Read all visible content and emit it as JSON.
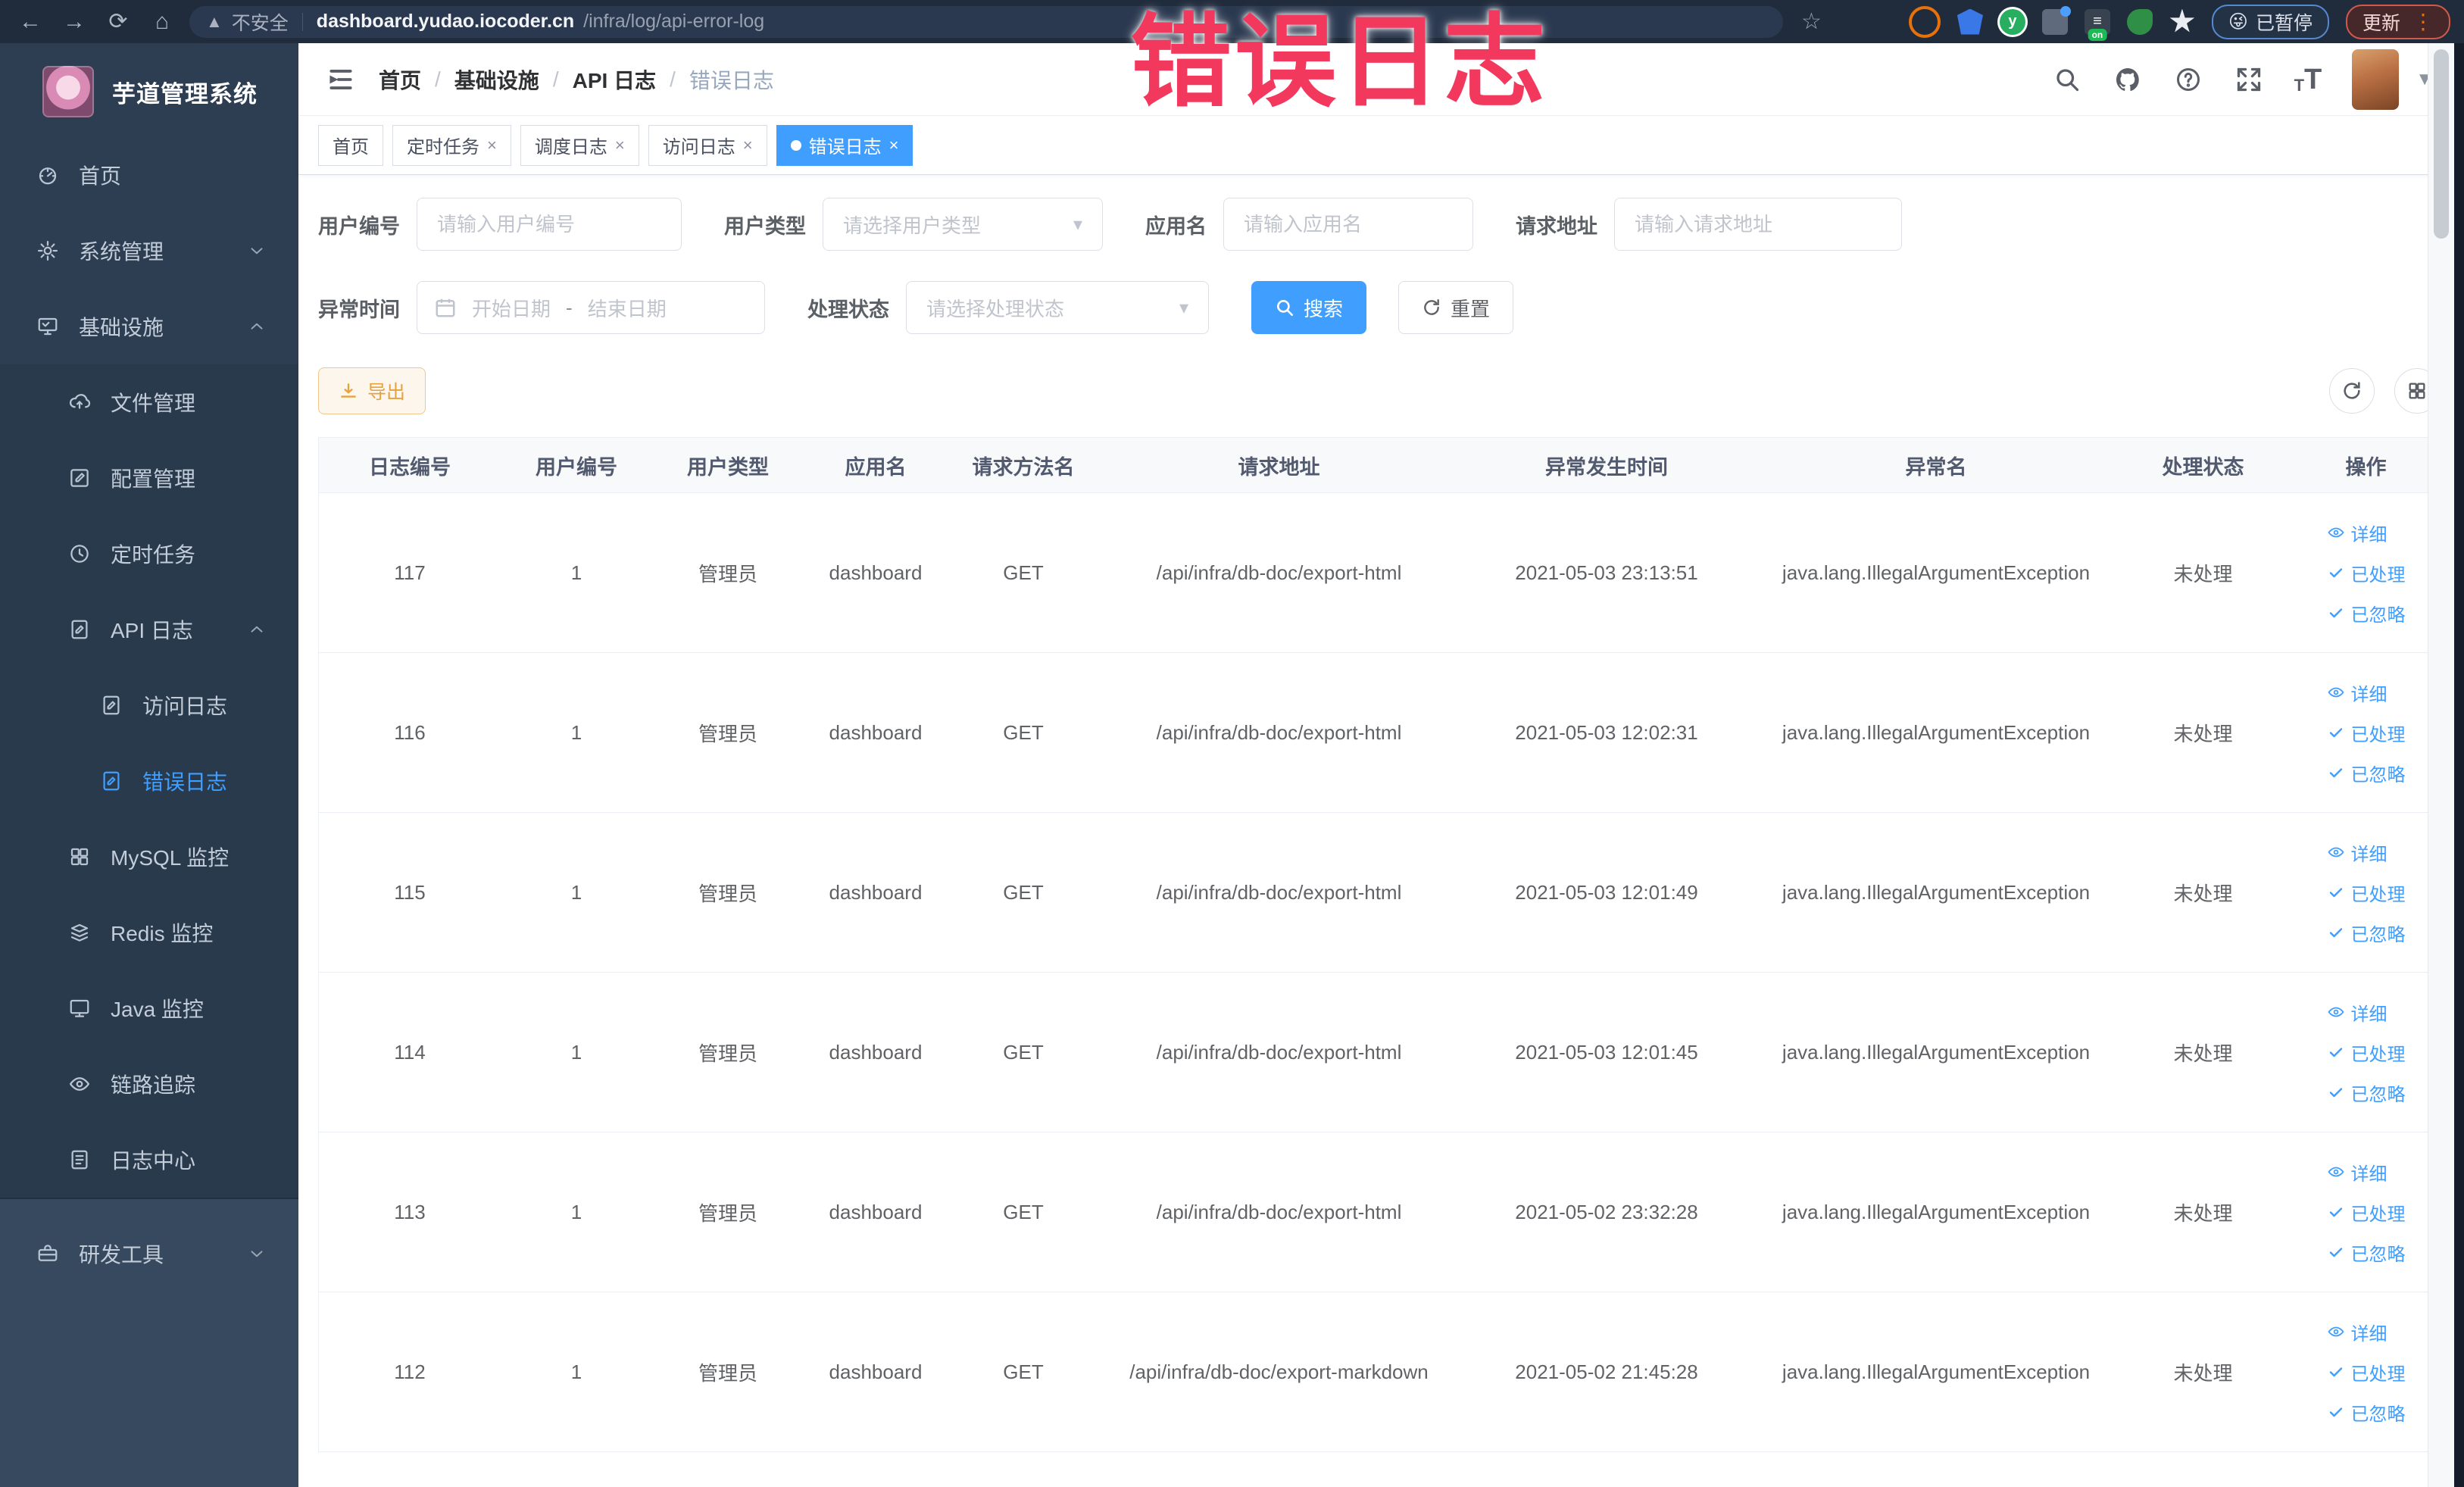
{
  "browser": {
    "security_label": "不安全",
    "url_domain": "dashboard.yudao.iocoder.cn",
    "url_path": "/infra/log/api-error-log",
    "paused_label": "已暂停",
    "paused_emoji": "😜",
    "update_label": "更新"
  },
  "annotation": {
    "text": "错误日志",
    "color": "#f2395d"
  },
  "sidebar": {
    "title": "芋道管理系统",
    "items": [
      {
        "label": "首页",
        "icon": "dashboard",
        "level": 0,
        "section": "top"
      },
      {
        "label": "系统管理",
        "icon": "gear",
        "level": 0,
        "chevron": "down",
        "section": "top"
      },
      {
        "label": "基础设施",
        "icon": "infrastructure",
        "level": 0,
        "chevron": "up",
        "section": "top"
      },
      {
        "label": "文件管理",
        "icon": "cloud-upload",
        "level": 1,
        "submenu": true,
        "section": "top"
      },
      {
        "label": "配置管理",
        "icon": "edit",
        "level": 1,
        "submenu": true,
        "section": "top"
      },
      {
        "label": "定时任务",
        "icon": "timer",
        "level": 1,
        "submenu": true,
        "section": "top"
      },
      {
        "label": "API 日志",
        "icon": "api-log",
        "level": 1,
        "chevron": "up",
        "submenu": true,
        "section": "top"
      },
      {
        "label": "访问日志",
        "icon": "doc-edit",
        "level": 2,
        "submenu": true,
        "section": "top"
      },
      {
        "label": "错误日志",
        "icon": "doc-edit",
        "level": 2,
        "submenu": true,
        "active": true,
        "section": "top"
      },
      {
        "label": "MySQL 监控",
        "icon": "mysql",
        "level": 1,
        "submenu": true,
        "section": "top"
      },
      {
        "label": "Redis 监控",
        "icon": "redis",
        "level": 1,
        "submenu": true,
        "section": "top"
      },
      {
        "label": "Java 监控",
        "icon": "java",
        "level": 1,
        "submenu": true,
        "section": "top"
      },
      {
        "label": "链路追踪",
        "icon": "trace",
        "level": 1,
        "submenu": true,
        "section": "top"
      },
      {
        "label": "日志中心",
        "icon": "log-center",
        "level": 1,
        "submenu": true,
        "section": "top"
      },
      {
        "label": "研发工具",
        "icon": "toolbox",
        "level": 0,
        "chevron": "down",
        "section": "bottom"
      }
    ]
  },
  "breadcrumb": [
    "首页",
    "基础设施",
    "API 日志",
    "错误日志"
  ],
  "tabs": [
    {
      "label": "首页",
      "closable": false,
      "active": false
    },
    {
      "label": "定时任务",
      "closable": true,
      "active": false
    },
    {
      "label": "调度日志",
      "closable": true,
      "active": false
    },
    {
      "label": "访问日志",
      "closable": true,
      "active": false
    },
    {
      "label": "错误日志",
      "closable": true,
      "active": true
    }
  ],
  "filters": {
    "user_id": {
      "label": "用户编号",
      "placeholder": "请输入用户编号"
    },
    "user_type": {
      "label": "用户类型",
      "placeholder": "请选择用户类型"
    },
    "app_name": {
      "label": "应用名",
      "placeholder": "请输入应用名"
    },
    "request_url": {
      "label": "请求地址",
      "placeholder": "请输入请求地址"
    },
    "exception_time": {
      "label": "异常时间",
      "start_placeholder": "开始日期",
      "separator": "-",
      "end_placeholder": "结束日期"
    },
    "process_status": {
      "label": "处理状态",
      "placeholder": "请选择处理状态"
    },
    "search_label": "搜索",
    "reset_label": "重置"
  },
  "toolbar": {
    "export_label": "导出"
  },
  "table": {
    "columns": [
      "日志编号",
      "用户编号",
      "用户类型",
      "应用名",
      "请求方法名",
      "请求地址",
      "异常发生时间",
      "异常名",
      "处理状态",
      "操作"
    ],
    "action_labels": [
      "详细",
      "已处理",
      "已忽略"
    ],
    "rows": [
      {
        "id": "117",
        "user_id": "1",
        "user_type": "管理员",
        "app": "dashboard",
        "method": "GET",
        "url": "/api/infra/db-doc/export-html",
        "time": "2021-05-03 23:13:51",
        "exception": "java.lang.IllegalArgumentException",
        "status": "未处理"
      },
      {
        "id": "116",
        "user_id": "1",
        "user_type": "管理员",
        "app": "dashboard",
        "method": "GET",
        "url": "/api/infra/db-doc/export-html",
        "time": "2021-05-03 12:02:31",
        "exception": "java.lang.IllegalArgumentException",
        "status": "未处理"
      },
      {
        "id": "115",
        "user_id": "1",
        "user_type": "管理员",
        "app": "dashboard",
        "method": "GET",
        "url": "/api/infra/db-doc/export-html",
        "time": "2021-05-03 12:01:49",
        "exception": "java.lang.IllegalArgumentException",
        "status": "未处理"
      },
      {
        "id": "114",
        "user_id": "1",
        "user_type": "管理员",
        "app": "dashboard",
        "method": "GET",
        "url": "/api/infra/db-doc/export-html",
        "time": "2021-05-03 12:01:45",
        "exception": "java.lang.IllegalArgumentException",
        "status": "未处理"
      },
      {
        "id": "113",
        "user_id": "1",
        "user_type": "管理员",
        "app": "dashboard",
        "method": "GET",
        "url": "/api/infra/db-doc/export-html",
        "time": "2021-05-02 23:32:28",
        "exception": "java.lang.IllegalArgumentException",
        "status": "未处理"
      },
      {
        "id": "112",
        "user_id": "1",
        "user_type": "管理员",
        "app": "dashboard",
        "method": "GET",
        "url": "/api/infra/db-doc/export-markdown",
        "time": "2021-05-02 21:45:28",
        "exception": "java.lang.IllegalArgumentException",
        "status": "未处理"
      }
    ]
  },
  "colors": {
    "accent": "#409eff",
    "warning": "#e6a23c",
    "annotation": "#f2395d",
    "sidebar_bg": "#2d3e53"
  }
}
